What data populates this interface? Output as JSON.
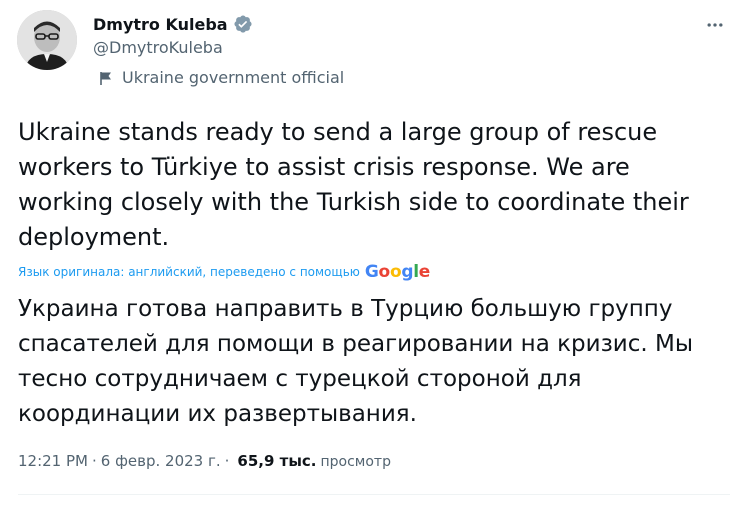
{
  "author": {
    "display_name": "Dmytro Kuleba",
    "handle": "@DmytroKuleba",
    "affiliation": "Ukraine government official",
    "verified_color": "#829aab"
  },
  "tweet": {
    "original_text": "Ukraine stands ready to send a large group of rescue workers to Türkiye to assist crisis response. We are working closely with the Turkish side to coordinate their deployment.",
    "translation_note": "Язык оригинала: английский, переведено с помощью",
    "translation_provider": "Google",
    "translated_text": "Украина готова направить в Турцию большую группу спасателей для помощи в реагировании на кризис. Мы тесно сотрудничаем с турецкой стороной для координации их развертывания.",
    "time": "12:21 PM",
    "date": "6 февр. 2023 г.",
    "separator": "·",
    "views_count": "65,9 тыс.",
    "views_label": "просмотр"
  },
  "colors": {
    "text": "#0f1419",
    "secondary": "#536471",
    "link": "#1d9bf0",
    "google_blue": "#4285f4",
    "google_red": "#ea4335",
    "google_yellow": "#fbbc05",
    "google_green": "#34a853"
  }
}
